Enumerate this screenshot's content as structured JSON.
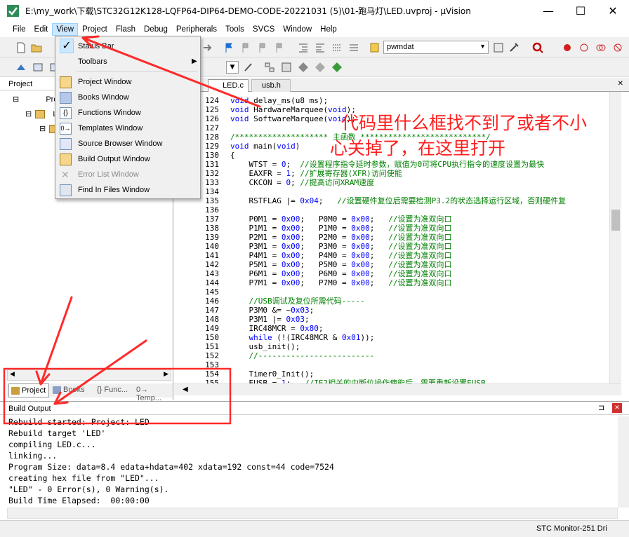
{
  "window": {
    "title": "E:\\my_work\\下载\\STC32G12K128-LQFP64-DIP64-DEMO-CODE-20221031 (5)\\01-跑马灯\\LED.uvproj - µVision",
    "minimize": "—",
    "maximize": "☐",
    "close": "✕"
  },
  "menubar": [
    "File",
    "Edit",
    "View",
    "Project",
    "Flash",
    "Debug",
    "Peripherals",
    "Tools",
    "SVCS",
    "Window",
    "Help"
  ],
  "toolbar": {
    "target_combo": "pwmdat"
  },
  "view_menu": {
    "items": [
      {
        "label": "Status Bar",
        "checked": true,
        "disabled": false
      },
      {
        "label": "Toolbars",
        "submenu": true,
        "disabled": false
      },
      {
        "label": "Project Window",
        "disabled": false
      },
      {
        "label": "Books Window",
        "disabled": false
      },
      {
        "label": "Functions Window",
        "disabled": false
      },
      {
        "label": "Templates Window",
        "disabled": false
      },
      {
        "label": "Source Browser Window",
        "disabled": false
      },
      {
        "label": "Build Output Window",
        "disabled": false
      },
      {
        "label": "Error List Window",
        "disabled": true
      },
      {
        "label": "Find In Files Window",
        "disabled": false
      }
    ]
  },
  "project_pane": {
    "header": "Project",
    "tree": [
      "Proje",
      "L"
    ],
    "tabs": [
      "Project",
      "Books",
      "{} Func...",
      "0→ Temp..."
    ]
  },
  "editor": {
    "tabs": [
      "LED.c",
      "usb.h"
    ],
    "lines": [
      {
        "n": "124",
        "t": "void delay_ms(u8 ms);"
      },
      {
        "n": "125",
        "t": "void HardwareMarquee(void);"
      },
      {
        "n": "126",
        "t": "void SoftwareMarquee(void);"
      },
      {
        "n": "127",
        "t": ""
      },
      {
        "n": "128",
        "t": "/******************** 主函数 ***************************/"
      },
      {
        "n": "129",
        "t": "void main(void)"
      },
      {
        "n": "130",
        "t": "{"
      },
      {
        "n": "131",
        "t": "    WTST = 0;  //设置程序指令延时参数，赋值为0可将CPU执行指令的速度设置为最快"
      },
      {
        "n": "132",
        "t": "    EAXFR = 1; //扩展寄存器(XFR)访问使能"
      },
      {
        "n": "133",
        "t": "    CKCON = 0; //提高访问XRAM速度"
      },
      {
        "n": "134",
        "t": ""
      },
      {
        "n": "135",
        "t": "    RSTFLAG |= 0x04;   //设置硬件复位后需要检测P3.2的状态选择运行区域，否则硬件复"
      },
      {
        "n": "136",
        "t": ""
      },
      {
        "n": "137",
        "t": "    P0M1 = 0x00;   P0M0 = 0x00;   //设置为准双向口"
      },
      {
        "n": "138",
        "t": "    P1M1 = 0x00;   P1M0 = 0x00;   //设置为准双向口"
      },
      {
        "n": "139",
        "t": "    P2M1 = 0x00;   P2M0 = 0x00;   //设置为准双向口"
      },
      {
        "n": "140",
        "t": "    P3M1 = 0x00;   P3M0 = 0x00;   //设置为准双向口"
      },
      {
        "n": "141",
        "t": "    P4M1 = 0x00;   P4M0 = 0x00;   //设置为准双向口"
      },
      {
        "n": "142",
        "t": "    P5M1 = 0x00;   P5M0 = 0x00;   //设置为准双向口"
      },
      {
        "n": "143",
        "t": "    P6M1 = 0x00;   P6M0 = 0x00;   //设置为准双向口"
      },
      {
        "n": "144",
        "t": "    P7M1 = 0x00;   P7M0 = 0x00;   //设置为准双向口"
      },
      {
        "n": "145",
        "t": ""
      },
      {
        "n": "146",
        "t": "    //USB调试及复位所需代码-----"
      },
      {
        "n": "147",
        "t": "    P3M0 &= ~0x03;"
      },
      {
        "n": "148",
        "t": "    P3M1 |= 0x03;"
      },
      {
        "n": "149",
        "t": "    IRC48MCR = 0x80;"
      },
      {
        "n": "150",
        "t": "    while (!(IRC48MCR & 0x01));"
      },
      {
        "n": "151",
        "t": "    usb_init();"
      },
      {
        "n": "152",
        "t": "    //-------------------------"
      },
      {
        "n": "153",
        "t": ""
      },
      {
        "n": "154",
        "t": "    Timer0_Init();"
      },
      {
        "n": "155",
        "t": "    EUSB = 1;   //IE2相关的中断位操作使能后，需要重新设置EUSB"
      }
    ]
  },
  "build_output": {
    "header": "Build Output",
    "pin": "⊐",
    "close": "✕",
    "lines": [
      "Rebuild started: Project: LED",
      "Rebuild target 'LED'",
      "compiling LED.c...",
      "linking...",
      "Program Size: data=8.4 edata+hdata=402 xdata=192 const=44 code=7524",
      "creating hex file from \"LED\"...",
      "\"LED\" - 0 Error(s), 0 Warning(s).",
      "Build Time Elapsed:  00:00:00"
    ]
  },
  "statusbar": {
    "debugger": "STC Monitor-251 Dri"
  },
  "annotation": {
    "line1": "代码里什么框找不到了或者不小",
    "line2": "心关掉了，在这里打开"
  },
  "colors": {
    "annotation_red": "#ff1e1e",
    "menu_highlight": "#cce8ff",
    "keyword": "#0000ff",
    "comment": "#008000"
  }
}
